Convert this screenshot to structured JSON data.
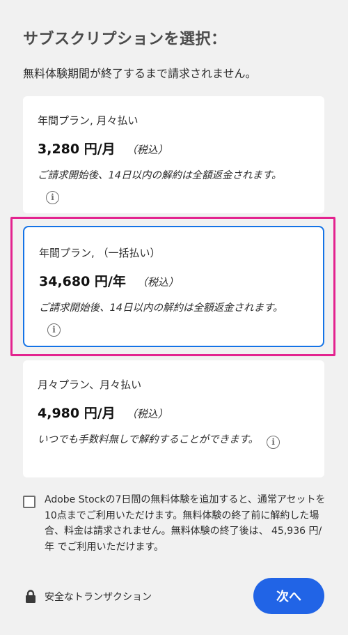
{
  "title": "サブスクリプションを選択：",
  "subtitle": "無料体験期間が終了するまで請求されません。",
  "plans": [
    {
      "name": "年間プラン, 月々払い",
      "price": "3,280 円/月",
      "tax": "（税込）",
      "note": "ご請求開始後、14日以内の解約は全額返金されます。",
      "selected": false
    },
    {
      "name": "年間プラン, （一括払い）",
      "price": "34,680 円/年",
      "tax": "（税込）",
      "note": "ご請求開始後、14日以内の解約は全額返金されます。",
      "selected": true
    },
    {
      "name": "月々プラン、月々払い",
      "price": "4,980 円/月",
      "tax": "（税込）",
      "note": "いつでも手数料無しで解約することができます。",
      "selected": false
    }
  ],
  "info_icon_glyph": "i",
  "addon": {
    "checked": false,
    "text": "Adobe Stockの7日間の無料体験を追加すると、通常アセットを10点までご利用いただけます。無料体験の終了前に解約した場合、料金は請求されません。無料体験の終了後は、 45,936 円/年 でご利用いただけます。"
  },
  "footer": {
    "secure_label": "安全なトランザクション",
    "next_label": "次へ"
  },
  "colors": {
    "accent": "#1473e6",
    "button": "#2164e6",
    "highlight": "#e3238f",
    "background": "#f1f1f1"
  }
}
